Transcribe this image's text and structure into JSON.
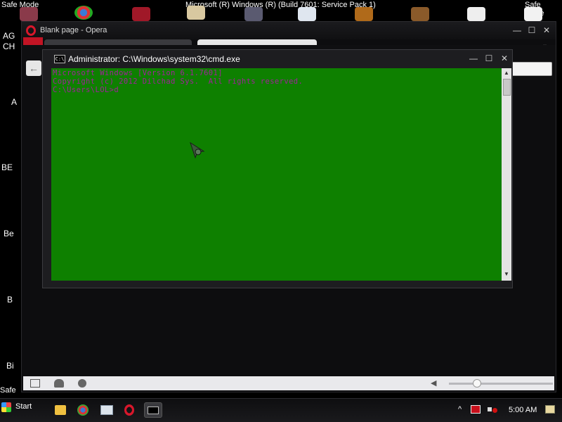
{
  "desktop": {
    "safe_mode_left": "Safe Mode",
    "safe_mode_right": "Safe Mode",
    "safe_mode_bottom": "Safe",
    "build_text": "Microsoft (R) Windows (R) (Build 7601: Service Pack 1)",
    "icon_labels": [
      "AG",
      "CH",
      "A",
      "BE",
      "Be",
      "B",
      "Bi"
    ]
  },
  "opera": {
    "title": "Blank page - Opera",
    "window_buttons": {
      "minimize": "—",
      "maximize": "☐",
      "close": "✕"
    },
    "back_label": "←",
    "tab_menu": "▾",
    "status_icons": [
      "panel-toggle-icon",
      "cloud-icon",
      "speed-icon",
      "view-icon"
    ],
    "zoom_level": 0.27
  },
  "cmd": {
    "title": "Administrator: C:\\Windows\\system32\\cmd.exe",
    "icon_text": "C:\\",
    "window_buttons": {
      "minimize": "—",
      "maximize": "☐",
      "close": "✕"
    },
    "lines": [
      "Microsoft Windows [Version 6.1.7601]",
      "Copyright (c) 2012 Dilchad Sys.  All rights reserved.",
      "",
      "C:\\Users\\LOL>d"
    ],
    "colors": {
      "background": "#0e8000",
      "text": "#a1209a"
    }
  },
  "taskbar": {
    "start_label": "Start",
    "items": [
      "folder-icon",
      "chrome-icon",
      "window-icon",
      "opera-icon",
      "cmd-icon"
    ],
    "tray": {
      "chevron": "^",
      "time": "5:00 AM"
    }
  }
}
